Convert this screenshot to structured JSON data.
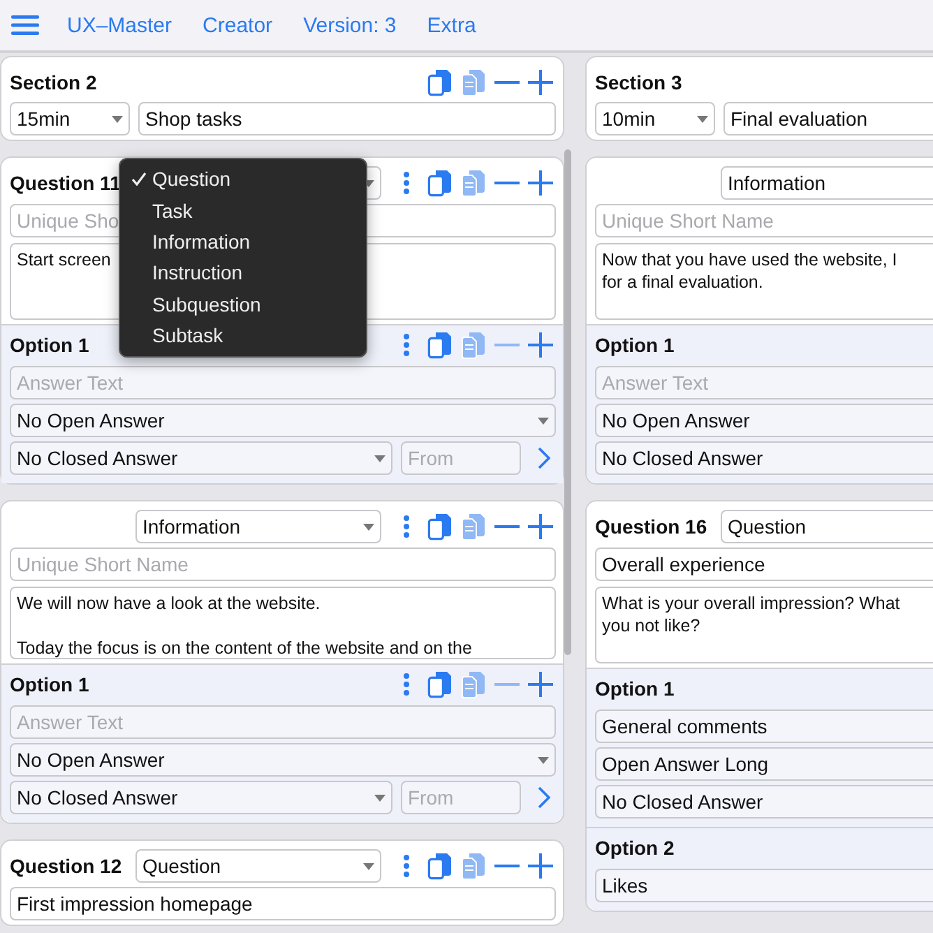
{
  "toolbar": {
    "items": [
      "UX–Master",
      "Creator",
      "Version: 3",
      "Extra"
    ]
  },
  "columns": [
    {
      "section": {
        "title": "Section 2",
        "duration": "15min",
        "name": "Shop tasks",
        "actions": {
          "remove_enabled": true
        }
      },
      "blocks": [
        {
          "heading": "Question 11",
          "type_menu": [
            {
              "label": "Question",
              "selected": true
            },
            {
              "label": "Task",
              "selected": false
            },
            {
              "label": "Information",
              "selected": false
            },
            {
              "label": "Instruction",
              "selected": false
            },
            {
              "label": "Subquestion",
              "selected": false
            },
            {
              "label": "Subtask",
              "selected": false
            }
          ],
          "short_name": {
            "placeholder": "Unique Sho"
          },
          "text": "Start screen",
          "actions": {
            "remove_enabled": true
          },
          "options": [
            {
              "title": "Option 1",
              "answer": {
                "placeholder": "Answer Text"
              },
              "open_answer": "No Open Answer",
              "closed_answer": "No Closed Answer",
              "from": {
                "placeholder": "From"
              },
              "actions": {
                "remove_enabled": false
              }
            }
          ]
        },
        {
          "type": "Information",
          "short_name": {
            "placeholder": "Unique Short Name"
          },
          "text": "We will now have a look at the website.\n\nToday the focus is on the content of the website and on the",
          "actions": {
            "remove_enabled": true
          },
          "options": [
            {
              "title": "Option 1",
              "answer": {
                "placeholder": "Answer Text"
              },
              "open_answer": "No Open Answer",
              "closed_answer": "No Closed Answer",
              "from": {
                "placeholder": "From"
              },
              "actions": {
                "remove_enabled": false
              }
            }
          ]
        },
        {
          "heading": "Question 12",
          "type": "Question",
          "short_name": {
            "value": "First impression homepage"
          },
          "actions": {
            "remove_enabled": true
          }
        }
      ]
    },
    {
      "section": {
        "title": "Section 3",
        "duration": "10min",
        "name": "Final evaluation"
      },
      "blocks": [
        {
          "type": "Information",
          "short_name": {
            "placeholder": "Unique Short Name"
          },
          "text": "Now that you have used the website, I\nfor a final evaluation.",
          "options": [
            {
              "title": "Option 1",
              "answer": {
                "placeholder": "Answer Text"
              },
              "open_answer": "No Open Answer",
              "closed_answer": "No Closed Answer"
            }
          ]
        },
        {
          "heading": "Question 16",
          "type": "Question",
          "short_name": {
            "value": "Overall experience"
          },
          "text": "What is your overall impression? What\nyou not like?",
          "options": [
            {
              "title": "Option 1",
              "answer": {
                "value": "General comments"
              },
              "open_answer": "Open Answer Long",
              "closed_answer": "No Closed Answer"
            },
            {
              "title": "Option 2",
              "answer": {
                "value": "Likes"
              }
            }
          ]
        }
      ]
    }
  ]
}
